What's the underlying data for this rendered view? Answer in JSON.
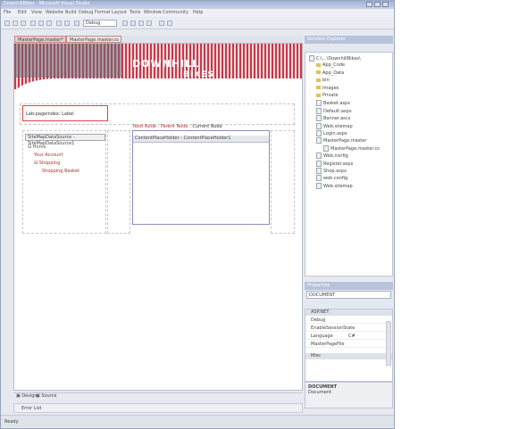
{
  "window": {
    "title": "DownhillBikes - Microsoft Visual Studio"
  },
  "menu": [
    "File",
    "Edit",
    "View",
    "Website",
    "Build",
    "Debug",
    "Format",
    "Layout",
    "Tools",
    "Window",
    "Community",
    "Help"
  ],
  "toolbar": {
    "config": "Debug"
  },
  "doc_tabs": [
    "MasterPage.master*",
    "MasterPage.master.cs"
  ],
  "design": {
    "banner_title_1": "DOWNHILL",
    "banner_title_2": "BIKES",
    "label_text": "Lab:pageindex: Label",
    "sitemapds_label": "SiteMapDataSource - SiteMapDataSource1",
    "tree": [
      "Home",
      "Your Account",
      "Shopping",
      "Shopping Basket"
    ],
    "sitemappath": {
      "root": "Root Node",
      "sep": " : ",
      "parent": "Parent Node",
      "current": "Current Node"
    },
    "cph_label": "ContentPlaceHolder - ContentPlaceHolder1"
  },
  "bottom_tabs": [
    "Design",
    "Source"
  ],
  "error_list": "Error List",
  "status": "Ready",
  "solution_explorer": {
    "title": "Solution Explorer",
    "items": [
      {
        "name": "C:\\...\\DownhillBikes\\",
        "type": "root"
      },
      {
        "name": "App_Code",
        "type": "folder"
      },
      {
        "name": "App_Data",
        "type": "folder"
      },
      {
        "name": "bin",
        "type": "folder"
      },
      {
        "name": "Images",
        "type": "folder"
      },
      {
        "name": "Private",
        "type": "folder"
      },
      {
        "name": "Basket.aspx",
        "type": "file"
      },
      {
        "name": "Default.aspx",
        "type": "file"
      },
      {
        "name": "Banner.ascx",
        "type": "file"
      },
      {
        "name": "Web.sitemap",
        "type": "file"
      },
      {
        "name": "Login.aspx",
        "type": "file"
      },
      {
        "name": "MasterPage.master",
        "type": "file"
      },
      {
        "name": "MasterPage.master.cs",
        "type": "subfile"
      },
      {
        "name": "Web.config",
        "type": "file"
      },
      {
        "name": "Register.aspx",
        "type": "file"
      },
      {
        "name": "Shop.aspx",
        "type": "file"
      },
      {
        "name": "web.config",
        "type": "file"
      },
      {
        "name": "Web.sitemap",
        "type": "file"
      }
    ]
  },
  "properties": {
    "title": "Properties",
    "object": "DOCUMENT",
    "category": "ASP.NET",
    "rows": [
      {
        "name": "Debug",
        "value": ""
      },
      {
        "name": "EnableSessionState",
        "value": ""
      },
      {
        "name": "Language",
        "value": "C#"
      },
      {
        "name": "MasterPageFile",
        "value": ""
      }
    ],
    "category2": "Misc",
    "desc_title": "DOCUMENT",
    "category3": "Document"
  }
}
